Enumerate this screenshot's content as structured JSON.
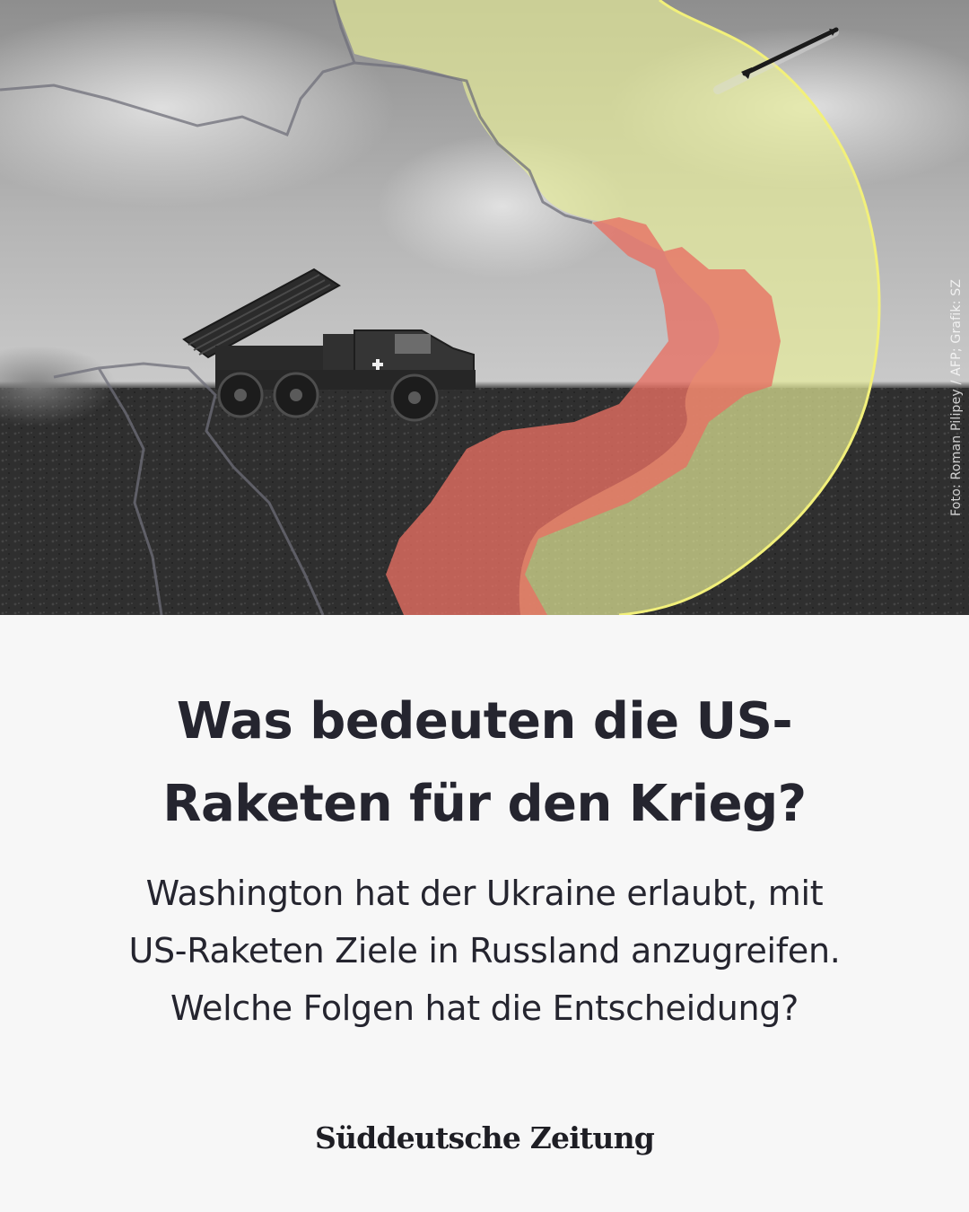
{
  "photo": {
    "subject": "multiple-rocket-launcher truck on a field",
    "credit": "Foto: Roman Pilipey / AFP; Grafik: SZ"
  },
  "map_overlay": {
    "range_fill": "#e8ee9a",
    "range_outline": "#f2f07a",
    "front_fill": "#e86f63"
  },
  "headline": {
    "line1": "Was bedeuten die US-",
    "line2": "Raketen für den Krieg?"
  },
  "dek": {
    "line1": "Washington hat der Ukraine erlaubt, mit",
    "line2": "US-Raketen Ziele in Russland anzugreifen.",
    "line3": "Welche Folgen hat die Entscheidung?"
  },
  "brand": {
    "name": "Süddeutsche Zeitung"
  }
}
